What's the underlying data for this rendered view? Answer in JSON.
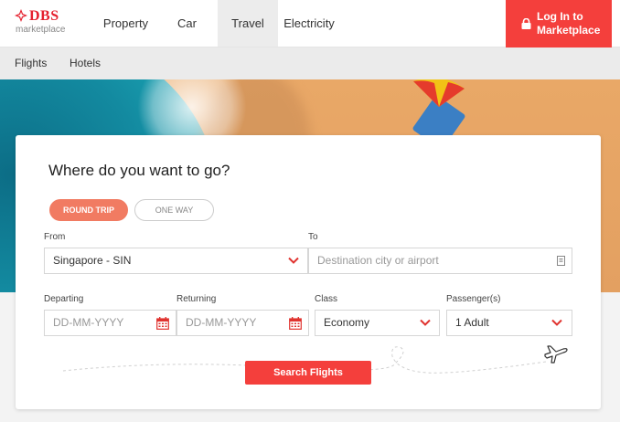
{
  "header": {
    "logo": {
      "brand": "DBS",
      "sub": "marketplace"
    },
    "nav": [
      "Property",
      "Car",
      "Travel",
      "Electricity"
    ],
    "active_nav": "Travel",
    "login_line1": "Log In to",
    "login_line2": "Marketplace"
  },
  "subnav": {
    "items": [
      "Flights",
      "Hotels"
    ]
  },
  "search": {
    "title": "Where do you want to go?",
    "trip_types": [
      "ROUND TRIP",
      "ONE WAY"
    ],
    "selected_trip": "ROUND TRIP",
    "from_label": "From",
    "from_value": "Singapore - SIN",
    "to_label": "To",
    "to_placeholder": "Destination city or airport",
    "departing_label": "Departing",
    "departing_placeholder": "DD-MM-YYYY",
    "returning_label": "Returning",
    "returning_placeholder": "DD-MM-YYYY",
    "class_label": "Class",
    "class_value": "Economy",
    "passengers_label": "Passenger(s)",
    "passengers_value": "1 Adult",
    "button_label": "Search Flights"
  },
  "colors": {
    "accent": "#f43f3c",
    "pill_active": "#f17b62",
    "chevron": "#e0332f"
  },
  "icons": [
    "dbs-logo-icon",
    "lock-icon",
    "chevron-down-icon",
    "calendar-icon",
    "airplane-icon",
    "id-card-icon"
  ]
}
